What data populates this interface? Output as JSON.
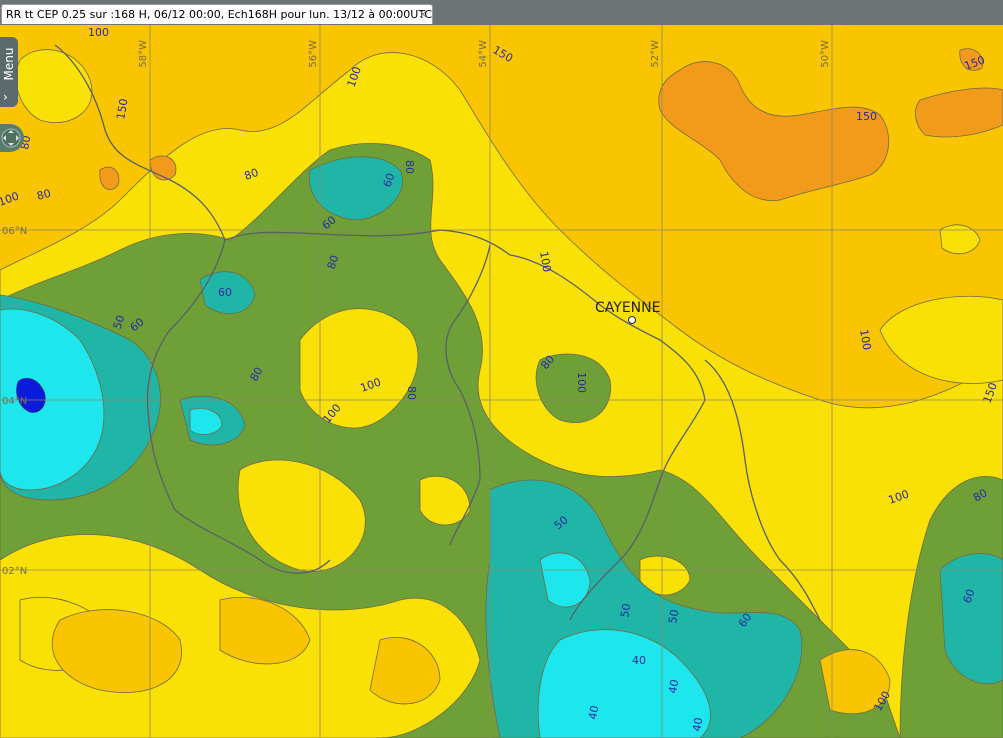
{
  "tab": {
    "title": "RR tt CEP 0.25 sur :168 H, 06/12 00:00, Ech168H pour lun. 13/12 à 00:00UTC",
    "close_symbol": "×"
  },
  "menu": {
    "label": "Menu",
    "chevron": "›"
  },
  "map": {
    "city": "CAYENNE",
    "longitudes": [
      "58°W",
      "56°W",
      "54°W",
      "52°W",
      "50°W"
    ],
    "latitudes": [
      "06°N",
      "04°N",
      "02°N"
    ],
    "contour_labels": [
      "100",
      "150",
      "80",
      "150",
      "100",
      "80",
      "150",
      "100",
      "80",
      "60",
      "80",
      "100",
      "60",
      "80",
      "60",
      "50",
      "60",
      "80",
      "100",
      "80",
      "100",
      "80",
      "100",
      "100",
      "50",
      "50",
      "50",
      "60",
      "40",
      "40",
      "40",
      "40",
      "100",
      "80",
      "60",
      "100",
      "150",
      "150"
    ]
  },
  "colors": {
    "over_150": "#f29b1a",
    "r100_150": "#f8c500",
    "r80_100": "#f9e105",
    "r60_80": "#6f9f37",
    "r50_60": "#1fb6a8",
    "r40_50": "#1de6ec",
    "under_40": "#0b1bdc",
    "contour_line": "#6f6a45",
    "border_line": "#5a5f6a"
  }
}
